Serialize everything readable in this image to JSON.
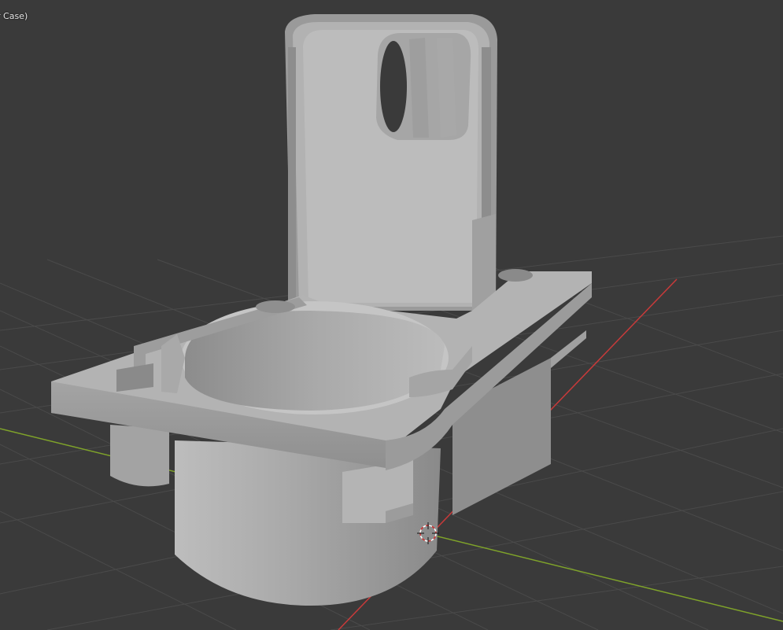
{
  "viewport": {
    "object_label": "r Case)",
    "background_color": "#3a3a3a",
    "grid_color": "#4a4a4a",
    "x_axis_color": "#c83a3a",
    "y_axis_color": "#7fa32a",
    "model_color": "#9a9a9a",
    "cursor_icon": "3d-cursor-icon"
  }
}
